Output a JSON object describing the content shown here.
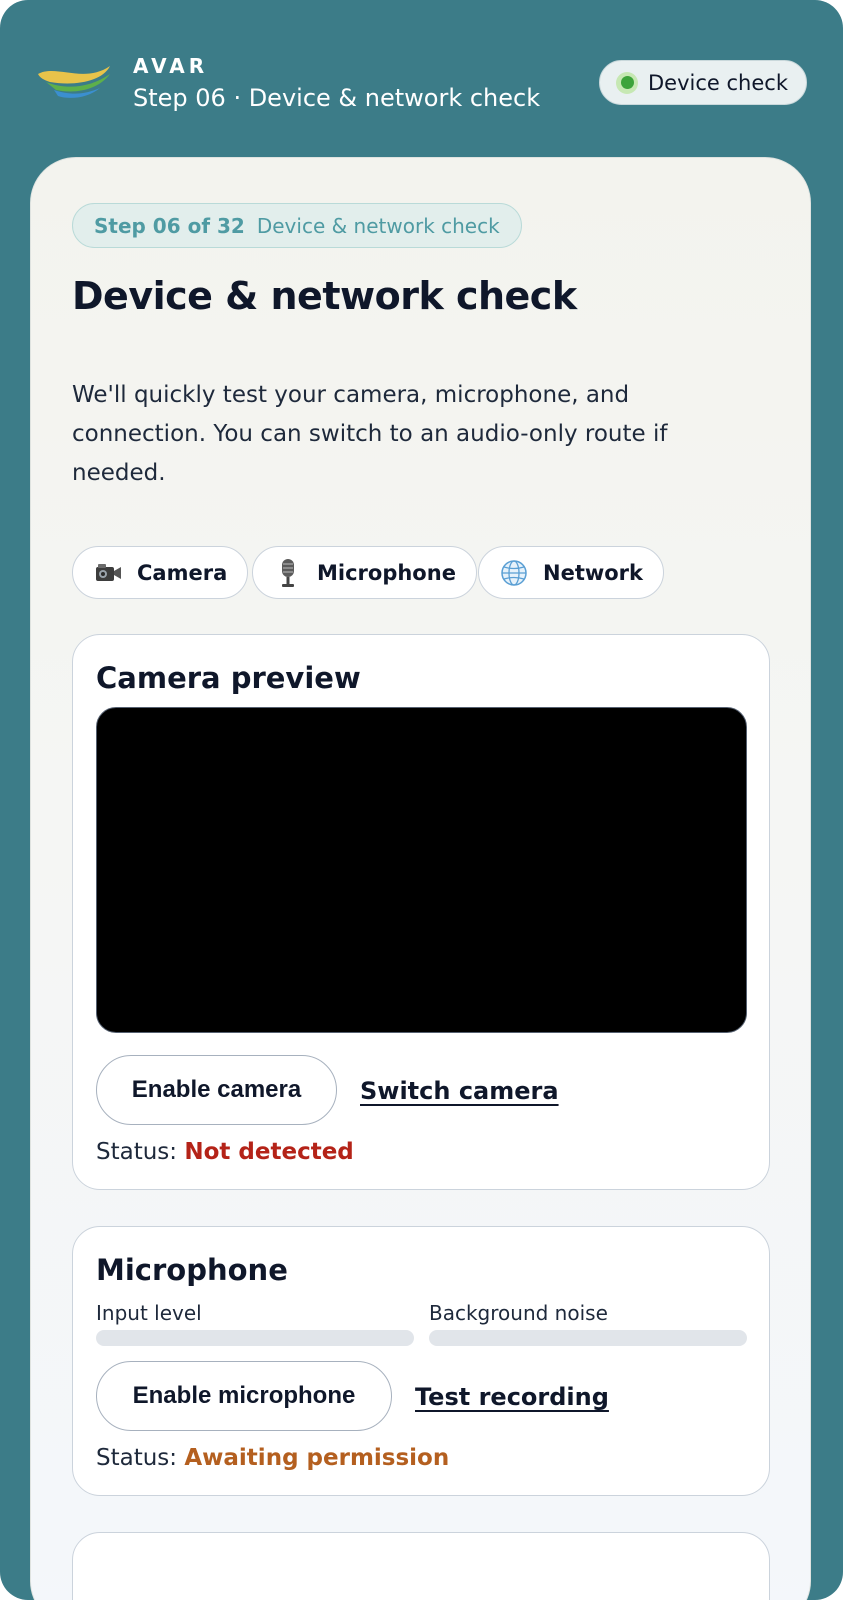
{
  "header": {
    "brand": "AVAR",
    "subtitle": "Step 06 · Device & network check",
    "status_pill": "Device check",
    "status_color": "#3ca33a"
  },
  "badge": {
    "step": "Step 06 of 32",
    "label": "Device & network check"
  },
  "title": "Device & network check",
  "intro": "We'll quickly test your camera, microphone, and connection. You can switch to an audio-only route if needed.",
  "chips": [
    {
      "label": "Camera",
      "icon": "camera-icon"
    },
    {
      "label": "Microphone",
      "icon": "microphone-icon"
    },
    {
      "label": "Network",
      "icon": "globe-icon"
    }
  ],
  "camera": {
    "heading": "Camera preview",
    "enable_label": "Enable camera",
    "switch_label": "Switch camera",
    "status_prefix": "Status:",
    "status_value": "Not detected",
    "status_color": "#b42318"
  },
  "microphone": {
    "heading": "Microphone",
    "input_label": "Input level",
    "noise_label": "Background noise",
    "input_level": 0,
    "noise_level": 0,
    "enable_label": "Enable microphone",
    "test_label": "Test recording",
    "status_prefix": "Status:",
    "status_value": "Awaiting permission",
    "status_color": "#b45f1f"
  },
  "colors": {
    "frame": "#3c7c88",
    "accent": "#4f9ba3"
  }
}
